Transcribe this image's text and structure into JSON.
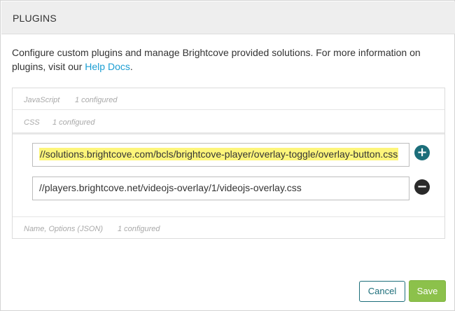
{
  "header": {
    "title": "PLUGINS"
  },
  "description": {
    "text": "Configure custom plugins and manage Brightcove provided solutions. For more information on plugins, visit our ",
    "link": "Help Docs",
    "suffix": "."
  },
  "sections": {
    "javascript": {
      "label": "JavaScript",
      "count": "1 configured"
    },
    "css": {
      "label": "CSS",
      "count": "1 configured"
    },
    "name": {
      "label": "Name, Options (JSON)",
      "count": "1 configured"
    }
  },
  "css_urls": [
    {
      "value": "//solutions.brightcove.com/bcls/brightcove-player/overlay-toggle/overlay-button.css",
      "highlighted": true
    },
    {
      "value": "//players.brightcove.net/videojs-overlay/1/videojs-overlay.css",
      "highlighted": false
    }
  ],
  "icons": {
    "add": "plus-circle-icon",
    "remove": "minus-circle-icon"
  },
  "colors": {
    "link": "#1b9ed3",
    "add_button": "#1c6e7a",
    "remove_button": "#2a2a2a",
    "save_button": "#8cc14b",
    "highlight": "#fdf57a"
  },
  "footer": {
    "cancel_label": "Cancel",
    "save_label": "Save"
  }
}
